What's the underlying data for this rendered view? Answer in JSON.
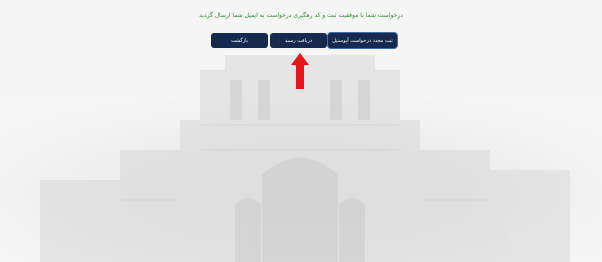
{
  "confirmation": {
    "message": "درخواست شما با موفقیت ثبت و کد رهگیری درخواست به ایمیل شما ارسال گردید"
  },
  "actions": {
    "renew_label": "ثبت مجدد درخواست آپوستیل",
    "receipt_label": "دریافت رسید",
    "back_label": "بازگشت"
  },
  "annotation": {
    "arrow_color": "#e8141c",
    "arrow_icon": "arrow-up-icon"
  },
  "theme": {
    "button_color": "#152a4e",
    "message_color": "#2b8a2b"
  }
}
